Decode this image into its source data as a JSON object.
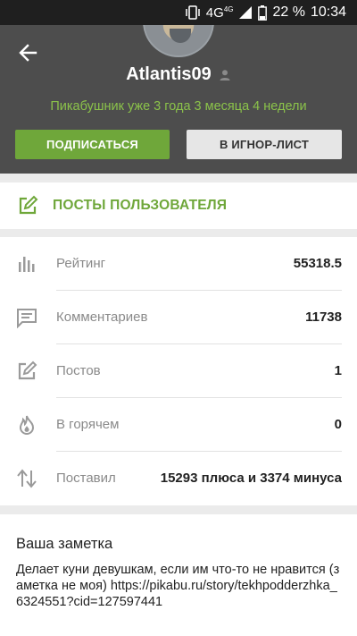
{
  "status_bar": {
    "network": "4G",
    "network_sub": "4G",
    "battery": "22 %",
    "time": "10:34"
  },
  "profile": {
    "username": "Atlantis09",
    "tenure": "Пикабушник уже 3 года 3 месяца 4 недели",
    "subscribe_label": "ПОДПИСАТЬСЯ",
    "ignore_label": "В ИГНОР-ЛИСТ"
  },
  "posts_link": {
    "label": "ПОСТЫ ПОЛЬЗОВАТЕЛЯ"
  },
  "stats": [
    {
      "icon": "rating-bars-icon",
      "label": "Рейтинг",
      "value": "55318.5"
    },
    {
      "icon": "comment-icon",
      "label": "Комментариев",
      "value": "11738"
    },
    {
      "icon": "edit-icon",
      "label": "Постов",
      "value": "1"
    },
    {
      "icon": "fire-icon",
      "label": "В горячем",
      "value": "0"
    },
    {
      "icon": "up-down-arrows-icon",
      "label": "Поставил",
      "value": "15293 плюса и 3374 минуса"
    }
  ],
  "note": {
    "title": "Ваша заметка",
    "text": "Делает куни девушкам, если им что-то не нравится (заметка не моя) https://pikabu.ru/story/tekhpodderzhka_6324551?cid=127597441"
  },
  "colors": {
    "accent_green": "#6fa73a",
    "tenure_green": "#8bc34a",
    "header_bg": "#4d4d4d",
    "status_bg": "#1f1f1f"
  }
}
